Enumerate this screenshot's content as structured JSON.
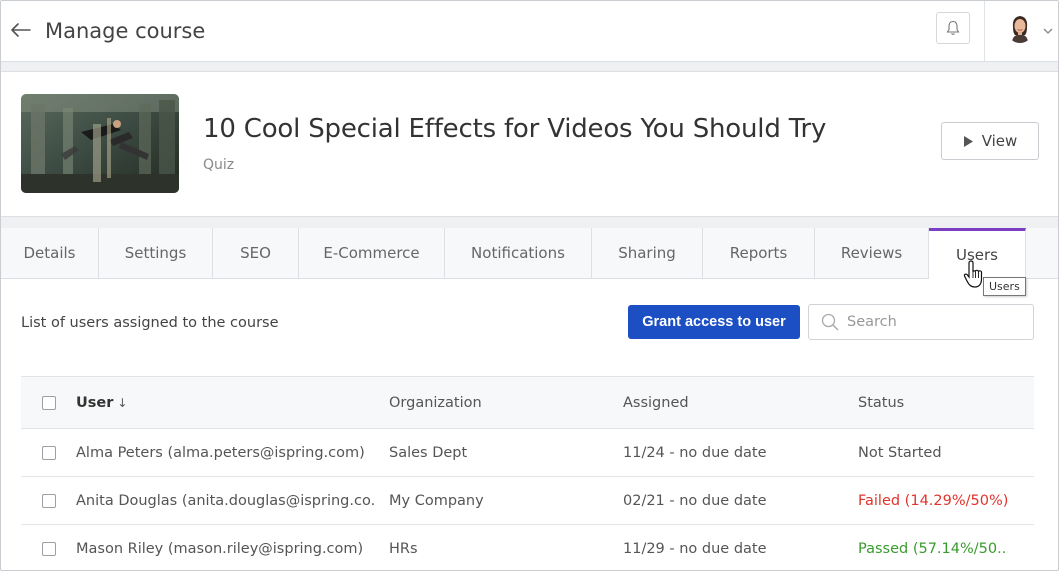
{
  "header": {
    "title": "Manage course"
  },
  "course": {
    "title": "10 Cool Special Effects for Videos You Should Try",
    "type": "Quiz",
    "view_label": "View"
  },
  "tabs": [
    {
      "label": "Details"
    },
    {
      "label": "Settings"
    },
    {
      "label": "SEO"
    },
    {
      "label": "E-Commerce"
    },
    {
      "label": "Notifications"
    },
    {
      "label": "Sharing"
    },
    {
      "label": "Reports"
    },
    {
      "label": "Reviews"
    },
    {
      "label": "Users"
    }
  ],
  "active_tab": "Users",
  "tooltip": "Users",
  "users_section": {
    "description": "List of users assigned to the course",
    "grant_label": "Grant access to user",
    "search_placeholder": "Search"
  },
  "table": {
    "columns": {
      "user": "User",
      "organization": "Organization",
      "assigned": "Assigned",
      "status": "Status"
    },
    "rows": [
      {
        "user": "Alma Peters (alma.peters@ispring.com)",
        "organization": "Sales Dept",
        "assigned": "11/24 - no due date",
        "status": "Not Started"
      },
      {
        "user": "Anita Douglas (anita.douglas@ispring.co...",
        "organization": "My Company",
        "assigned": "02/21 - no due date",
        "status": "Failed (14.29%/50%)"
      },
      {
        "user": "Mason Riley (mason.riley@ispring.com)",
        "organization": "HRs",
        "assigned": "11/29 - no due date",
        "status": "Passed (57.14%/50..."
      }
    ]
  },
  "colors": {
    "accent_tab": "#7d3ec4",
    "primary_button": "#1d4fc4",
    "failed": "#e0342d",
    "passed": "#3a9b2e"
  }
}
